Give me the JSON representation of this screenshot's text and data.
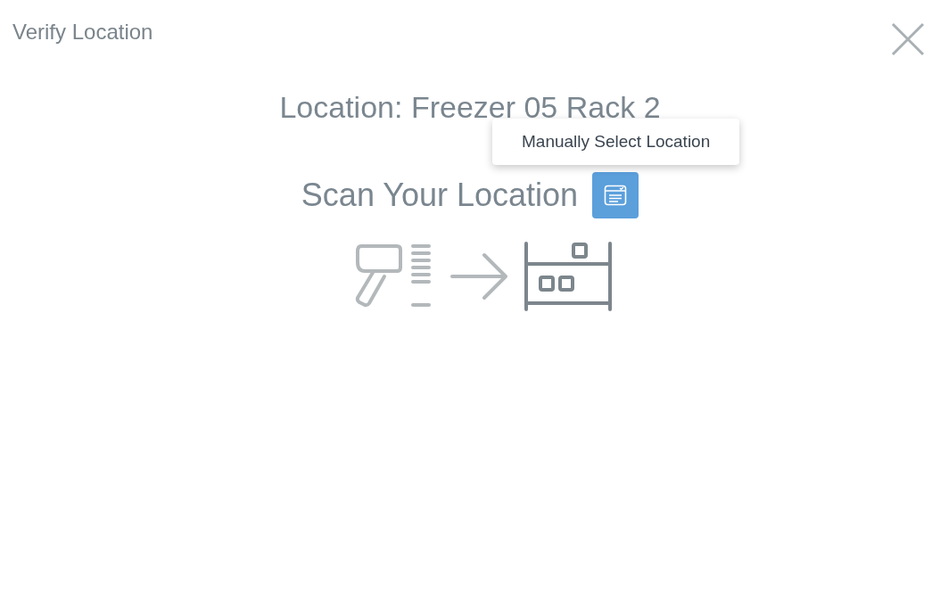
{
  "dialog": {
    "title": "Verify Location",
    "location": "Location: Freezer 05 Rack 2",
    "scan_prompt": "Scan Your Location",
    "manual_button": {
      "tooltip": "Manually Select Location"
    }
  }
}
